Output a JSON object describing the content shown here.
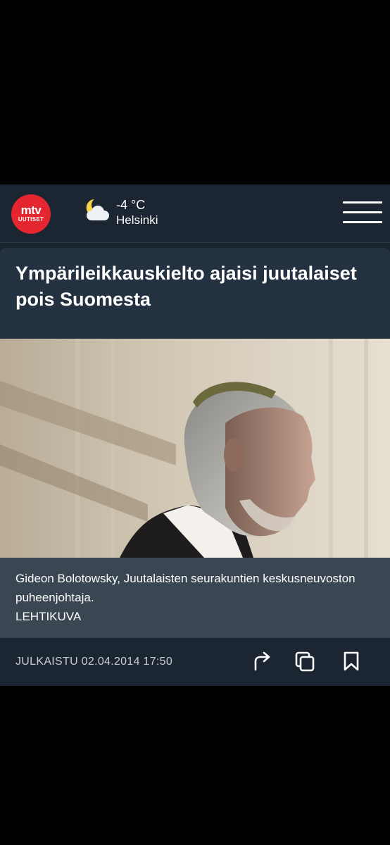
{
  "header": {
    "logo_main": "mtv",
    "logo_sub": "UUTISET",
    "weather": {
      "icon": "partly-cloudy-night-icon",
      "temperature": "-4 °C",
      "city": "Helsinki"
    },
    "menu_icon": "hamburger-menu-icon"
  },
  "article": {
    "headline": "Ympärileikkauskielto ajaisi juutalaiset pois Suomesta",
    "image": "photo of a man in a kippah shown in profile",
    "caption": "Gideon Bolotowsky, Juutalaisten seurakuntien keskusneuvoston puheenjohtaja.",
    "credit": "LEHTIKUVA",
    "published": "JULKAISTU 02.04.2014 17:50",
    "actions": [
      "share-icon",
      "copy-icon",
      "bookmark-icon"
    ]
  },
  "colors": {
    "background": "#000000",
    "header_bg": "#1c2632",
    "card_bg": "#243140",
    "caption_bg": "#3a4652",
    "brand_red": "#e3262f"
  }
}
